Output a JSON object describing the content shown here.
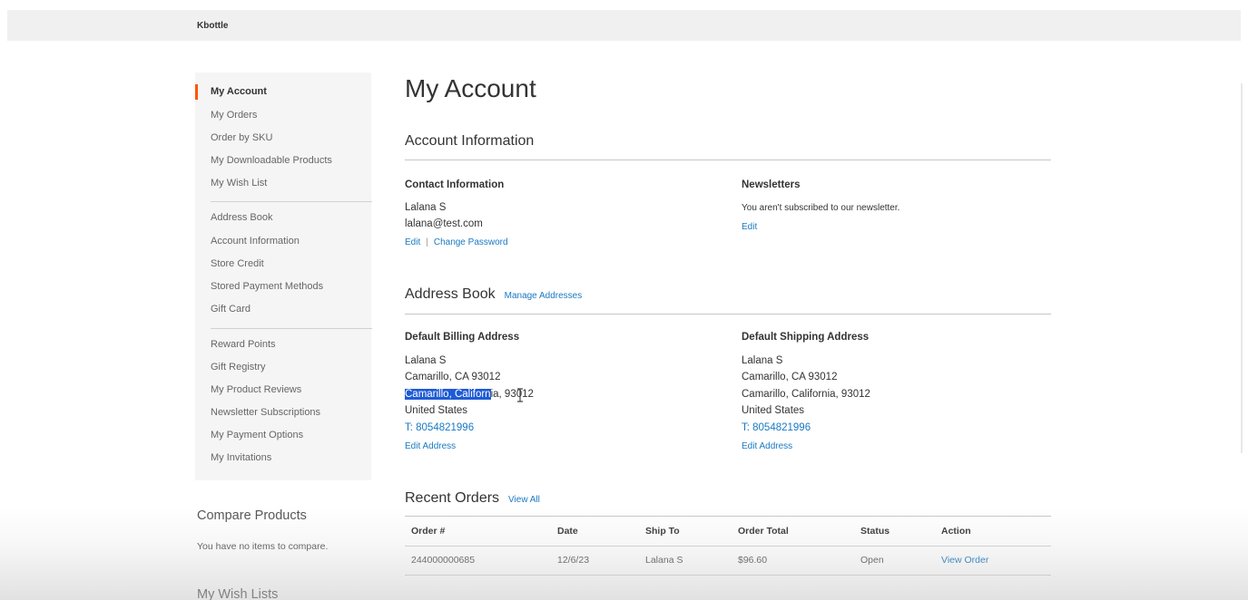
{
  "brand": "Kbottle",
  "sidebar": {
    "items": [
      {
        "label": "My Account",
        "active": true
      },
      {
        "label": "My Orders"
      },
      {
        "label": "Order by SKU"
      },
      {
        "label": "My Downloadable Products"
      },
      {
        "label": "My Wish List"
      },
      {
        "label": "Address Book"
      },
      {
        "label": "Account Information"
      },
      {
        "label": "Store Credit"
      },
      {
        "label": "Stored Payment Methods"
      },
      {
        "label": "Gift Card"
      },
      {
        "label": "Reward Points"
      },
      {
        "label": "Gift Registry"
      },
      {
        "label": "My Product Reviews"
      },
      {
        "label": "Newsletter Subscriptions"
      },
      {
        "label": "My Payment Options"
      },
      {
        "label": "My Invitations"
      }
    ],
    "compare": {
      "title": "Compare Products",
      "empty": "You have no items to compare."
    },
    "wishlists": {
      "title": "My Wish Lists"
    }
  },
  "main": {
    "title": "My Account",
    "account_info": {
      "title": "Account Information",
      "contact": {
        "title": "Contact Information",
        "name": "Lalana S",
        "email": "lalana@test.com",
        "edit": "Edit",
        "separator": "|",
        "change_password": "Change Password"
      },
      "newsletters": {
        "title": "Newsletters",
        "status": "You aren't subscribed to our newsletter.",
        "edit": "Edit"
      }
    },
    "address_book": {
      "title": "Address Book",
      "manage": "Manage Addresses",
      "billing": {
        "title": "Default Billing Address",
        "name": "Lalana S",
        "line1": "Camarillo, CA 93012",
        "line2_selected": "Camarillo, Californ",
        "line2_rest": "ia, 93012",
        "country": "United States",
        "phone_prefix": "T: ",
        "phone": "8054821996",
        "edit": "Edit Address"
      },
      "shipping": {
        "title": "Default Shipping Address",
        "name": "Lalana S",
        "line1": "Camarillo, CA 93012",
        "line2": "Camarillo, California, 93012",
        "country": "United States",
        "phone_prefix": "T: ",
        "phone": "8054821996",
        "edit": "Edit Address"
      }
    },
    "recent_orders": {
      "title": "Recent Orders",
      "view_all": "View All",
      "columns": [
        "Order #",
        "Date",
        "Ship To",
        "Order Total",
        "Status",
        "Action"
      ],
      "rows": [
        {
          "order": "244000000685",
          "date": "12/6/23",
          "ship_to": "Lalana S",
          "total": "$96.60",
          "status": "Open",
          "action": "View Order"
        }
      ]
    }
  },
  "colors": {
    "accent": "#ff5501",
    "link": "#1979c3",
    "selection": "#1e5bd6"
  }
}
